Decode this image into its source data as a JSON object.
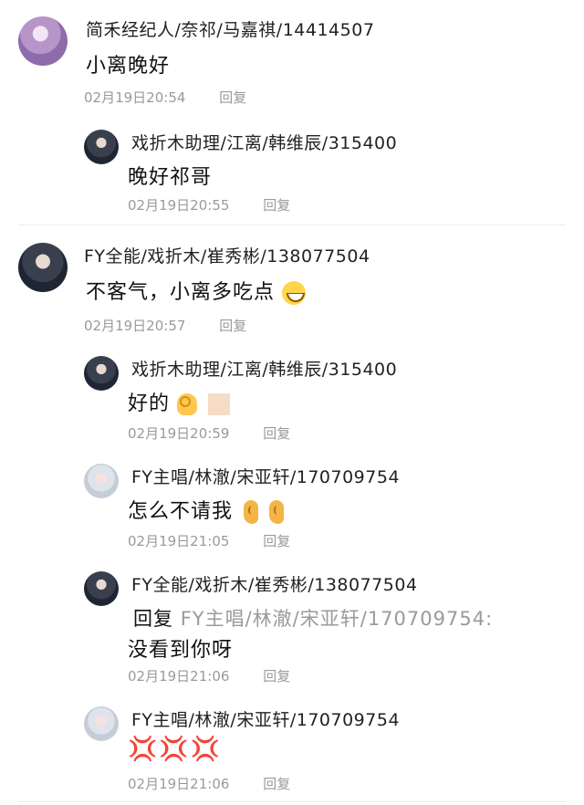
{
  "comments": [
    {
      "name": "简禾经纪人/奈祁/马嘉祺/14414507",
      "text": "小离晚好",
      "time": "02月19日20:54",
      "reply": "回复"
    },
    {
      "name": "戏折木助理/江离/韩维辰/315400",
      "text": "晚好祁哥",
      "time": "02月19日20:55",
      "reply": "回复"
    },
    {
      "name": "FY全能/戏折木/崔秀彬/138077504",
      "text": "不客气，小离多吃点",
      "emoji": "grinning-emoji",
      "time": "02月19日20:57",
      "reply": "回复"
    },
    {
      "name": "戏折木助理/江离/韩维辰/315400",
      "text": "好的",
      "emoji": "ok-hand-emoji",
      "time": "02月19日20:59",
      "reply": "回复"
    },
    {
      "name": "FY主唱/林澈/宋亚轩/170709754",
      "text": "怎么不请我",
      "emoji": "ear-emoji",
      "time": "02月19日21:05",
      "reply": "回复"
    },
    {
      "name": "FY全能/戏折木/崔秀彬/138077504",
      "reply_prefix": "回复",
      "reply_target": "FY主唱/林澈/宋亚轩/170709754:",
      "text": "没看到你呀",
      "time": "02月19日21:06",
      "reply": "回复"
    },
    {
      "name": "FY主唱/林澈/宋亚轩/170709754",
      "text": "💢💢💢",
      "time": "02月19日21:06",
      "reply": "回复"
    }
  ]
}
